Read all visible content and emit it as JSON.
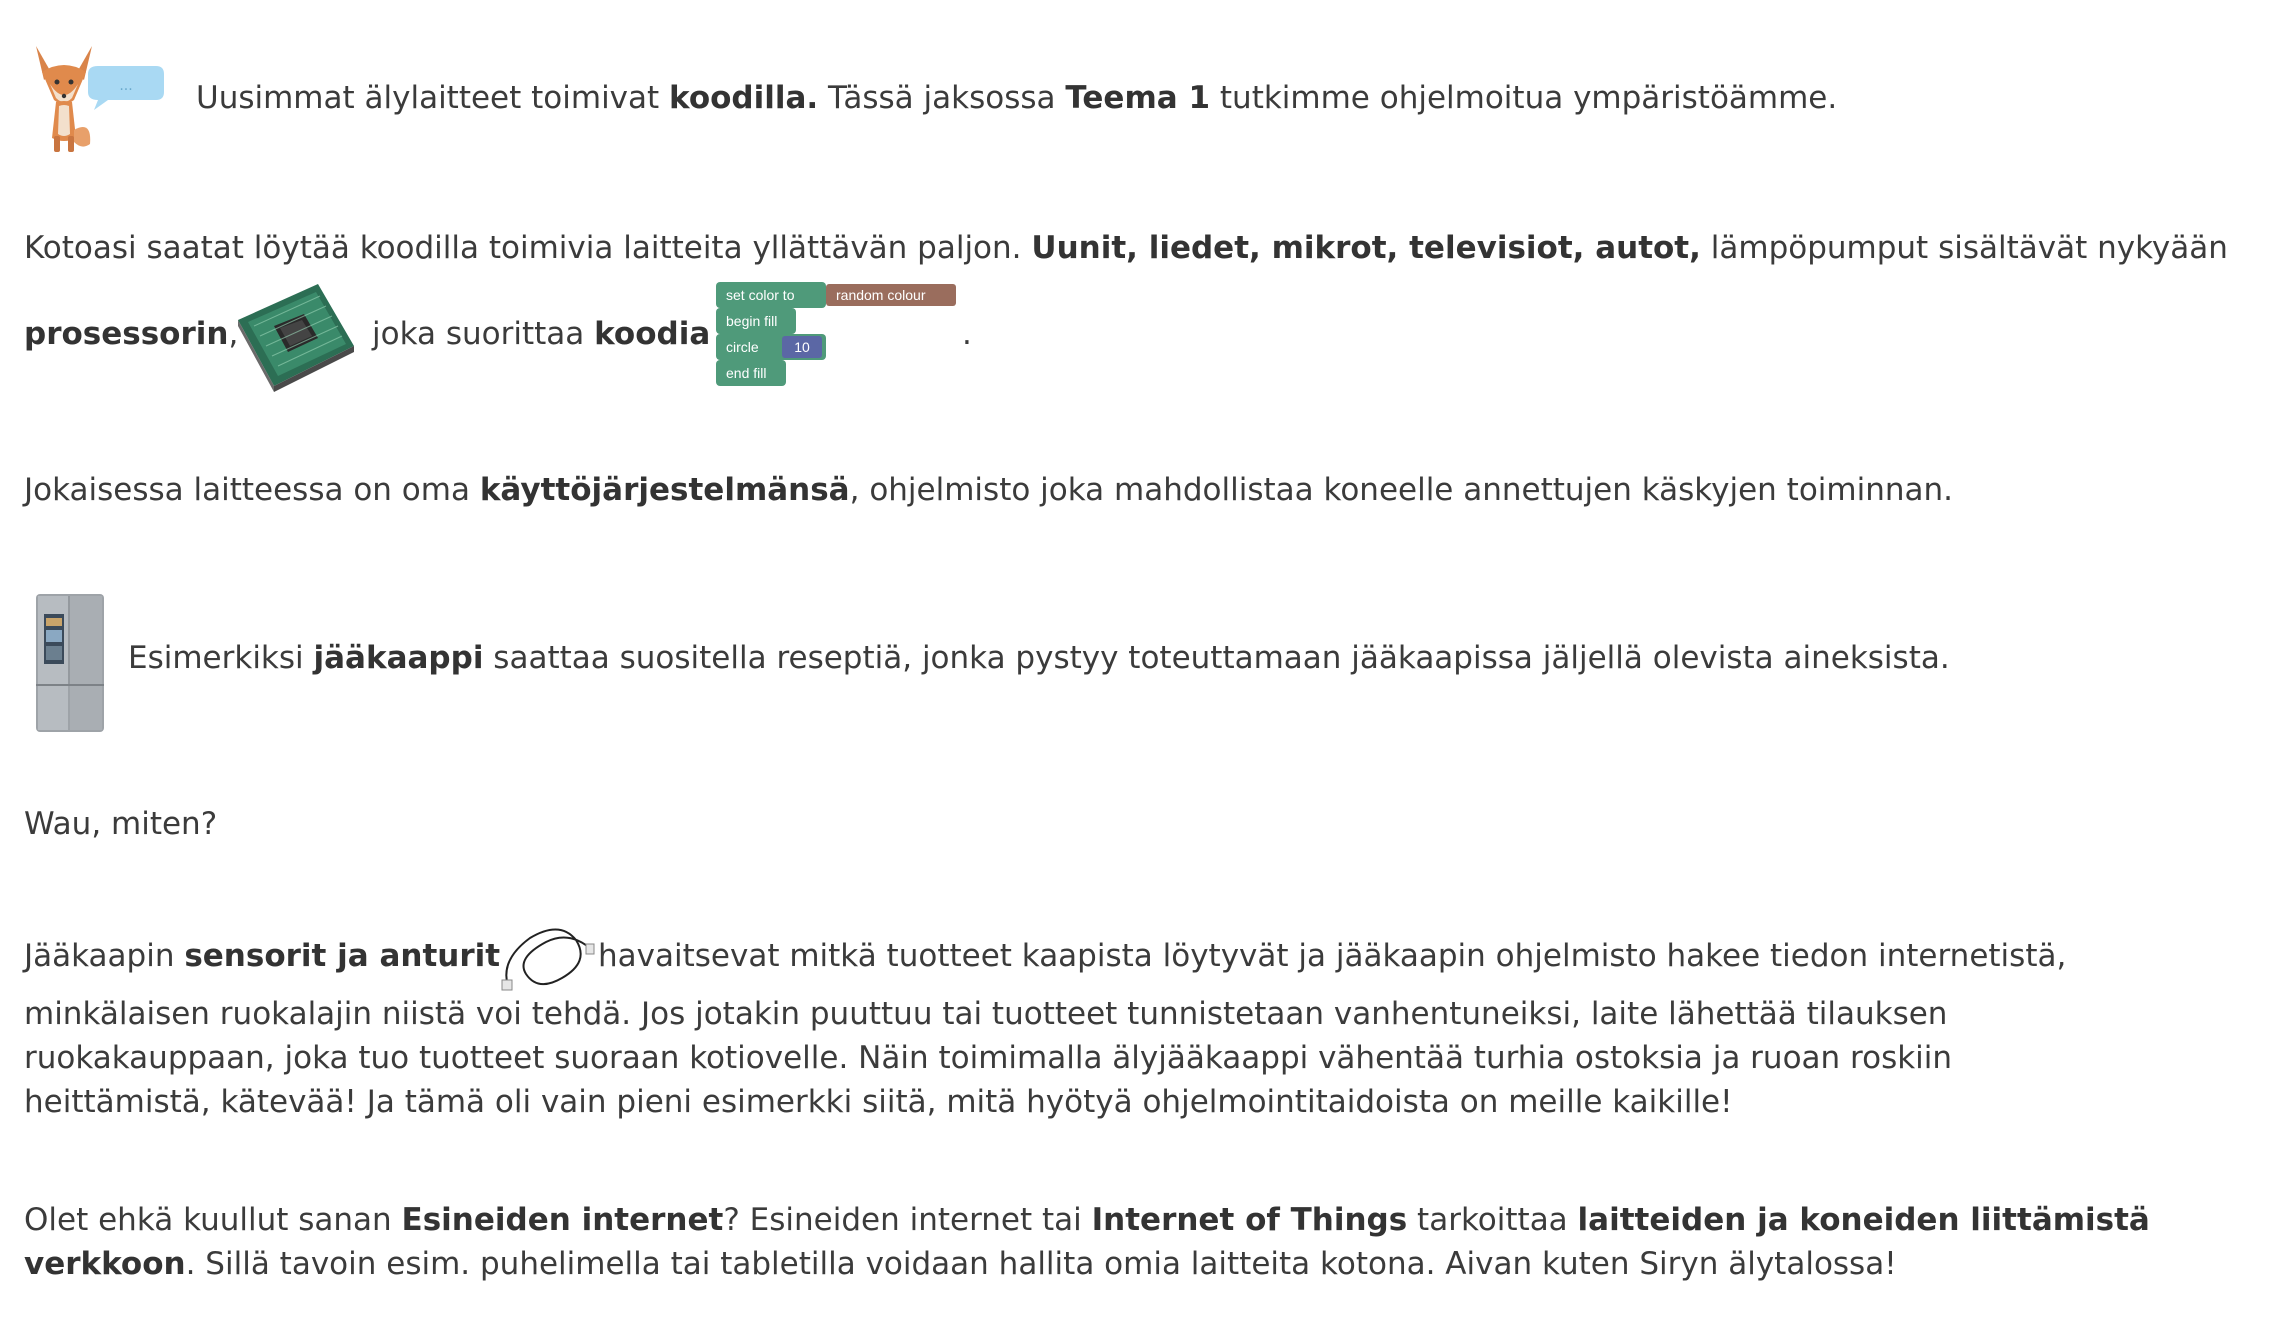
{
  "intro": {
    "t1": "Uusimmat älylaitteet toimivat ",
    "b1": "koodilla.",
    "t2": " Tässä jaksossa ",
    "b2": "Teema 1",
    "t3": " tutkimme ohjelmoitua ympäristöämme.",
    "bubble": "..."
  },
  "para2": {
    "t1": "Kotoasi saatat löytää koodilla toimivia laitteita yllättävän paljon. ",
    "b1": "Uunit, liedet, mikrot, televisiot, autot,",
    "t2": " lämpöpumput sisältävät nykyään",
    "b2": "prosessorin",
    "t3": ",",
    "t4": "joka suorittaa ",
    "b3": "koodia",
    "t5": "."
  },
  "code_blocks": {
    "set_color": "set color to",
    "color_value": "random colour",
    "begin_fill": "begin fill",
    "circle": "circle",
    "circle_value": "10",
    "end_fill": "end fill"
  },
  "para3": {
    "t1": "Jokaisessa laitteessa on oma ",
    "b1": "käyttöjärjestelmänsä",
    "t2": ", ohjelmisto joka mahdollistaa koneelle annettujen käskyjen toiminnan."
  },
  "para4": {
    "t1": "Esimerkiksi ",
    "b1": "jääkaappi",
    "t2": " saattaa suositella reseptiä, jonka pystyy toteuttamaan jääkaapissa jäljellä olevista aineksista."
  },
  "para5": {
    "t1": "Wau, miten?"
  },
  "para6": {
    "t1": "Jääkaapin ",
    "b1": "sensorit ja anturit",
    "t2": "havaitsevat mitkä tuotteet kaapista löytyvät ja jääkaapin ohjelmisto hakee tiedon internetistä,",
    "l2": "minkälaisen ruokalajin niistä voi tehdä. Jos jotakin puuttuu tai tuotteet tunnistetaan vanhentuneiksi, laite lähettää tilauksen",
    "l3": "ruokakauppaan, joka tuo tuotteet suoraan kotiovelle. Näin toimimalla älyjääkaappi vähentää turhia ostoksia ja ruoan roskiin",
    "l4": "heittämistä, kätevää! Ja tämä oli vain pieni esimerkki siitä, mitä hyötyä ohjelmointitaidoista on meille kaikille!"
  },
  "para7": {
    "t1": "Olet ehkä kuullut sanan ",
    "b1": "Esineiden internet",
    "t2": "? Esineiden internet tai ",
    "b2": "Internet of Things",
    "t3": " tarkoittaa ",
    "b3": "laitteiden ja koneiden liittämistä",
    "b4": "verkkoon",
    "t4": ". Sillä tavoin esim. puhelimella tai tabletilla voidaan hallita omia laitteita kotona. Aivan kuten Siryn älytalossa!"
  },
  "colors": {
    "text": "#3b3b3b",
    "block_green": "#4f9a7a",
    "block_brown": "#9a6d5d",
    "block_number": "#5b67a5",
    "bubble": "#a9d9f3"
  }
}
